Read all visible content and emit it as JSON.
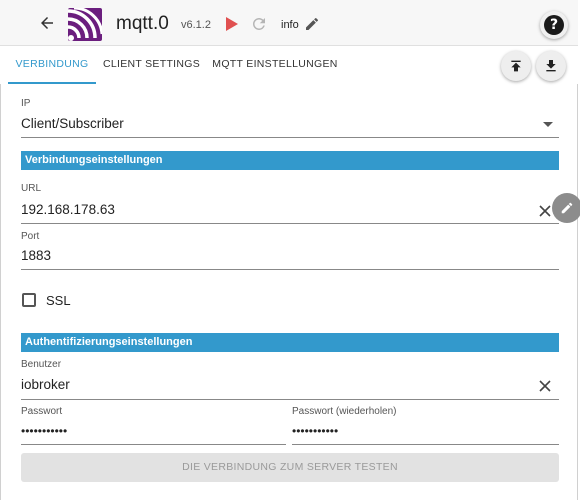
{
  "header": {
    "title": "mqtt.0",
    "version": "v6.1.2",
    "info_label": "info",
    "help_label": "?"
  },
  "tabs": [
    {
      "label": "VERBINDUNG",
      "active": true
    },
    {
      "label": "CLIENT SETTINGS",
      "active": false
    },
    {
      "label": "MQTT EINSTELLUNGEN",
      "active": false
    }
  ],
  "form": {
    "ip": {
      "label": "IP",
      "value": "Client/Subscriber"
    },
    "section_connection": "Verbindungseinstellungen",
    "url": {
      "label": "URL",
      "value": "192.168.178.63"
    },
    "port": {
      "label": "Port",
      "value": "1883"
    },
    "ssl": {
      "label": "SSL",
      "checked": false
    },
    "section_auth": "Authentifizierungseinstellungen",
    "user": {
      "label": "Benutzer",
      "value": "iobroker"
    },
    "password": {
      "label": "Passwort",
      "value": "•••••••••••"
    },
    "password_repeat": {
      "label": "Passwort (wiederholen)",
      "value": "•••••••••••"
    },
    "test_button": "DIE VERBINDUNG ZUM SERVER TESTEN"
  },
  "colors": {
    "accent": "#3399cc",
    "logo_bg": "#6b1e7e",
    "play": "#e05050",
    "disabled_button_bg": "#e2e2e2",
    "disabled_button_text": "#9a9a9a"
  },
  "icons": [
    "back-arrow-icon",
    "mqtt-logo-icon",
    "play-icon",
    "reload-icon",
    "edit-pencil-icon",
    "help-icon",
    "upload-icon",
    "download-icon",
    "clear-icon",
    "dropdown-arrow-icon"
  ]
}
